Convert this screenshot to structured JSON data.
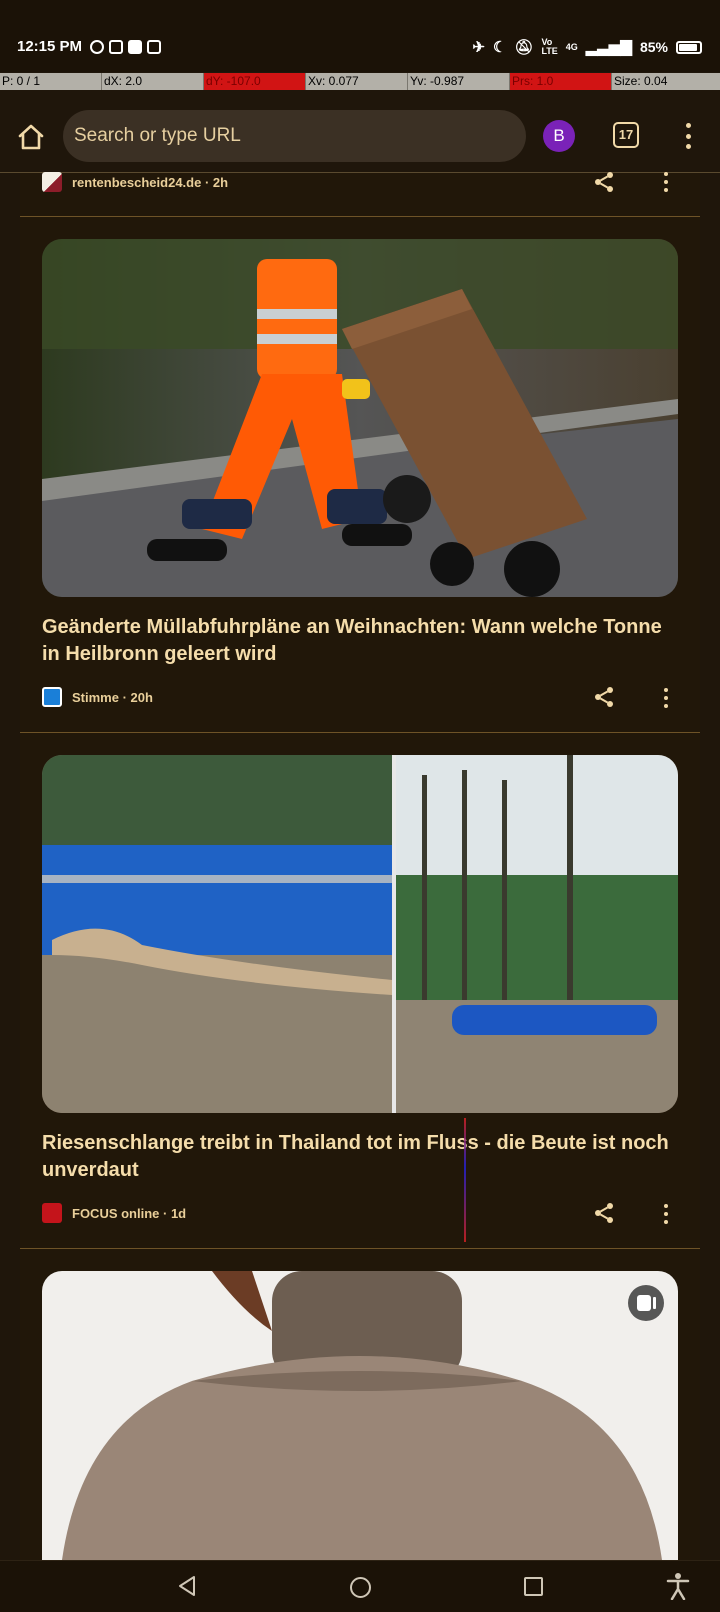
{
  "status_bar": {
    "time": "12:15 PM",
    "network": "4G",
    "battery": "85%",
    "left_icons": [
      "record-icon",
      "vibrate-icon",
      "app-icon",
      "eye-icon"
    ],
    "right_icons": [
      "airplane-off-icon",
      "moon-icon",
      "bell-off-icon",
      "volte-icon",
      "signal-icon",
      "battery-icon"
    ]
  },
  "debug_bar": {
    "cells": [
      "P: 0 / 1",
      "dX: 2.0",
      "dY: -107.0",
      "Xv: 0.077",
      "Yv: -0.987",
      "Prs: 1.0",
      "Size: 0.04"
    ],
    "red_cells": [
      2,
      5
    ]
  },
  "toolbar": {
    "url_placeholder": "Search or type URL",
    "avatar_letter": "B",
    "tab_count": "17"
  },
  "feed": {
    "cards": [
      {
        "source": "rentenbescheid24.de · 2h",
        "title": ""
      },
      {
        "source": "Stimme · 20h",
        "title": "Geänderte Müllabfuhrpläne an Weihnachten: Wann welche Tonne in Heilbronn geleert wird"
      },
      {
        "source": "FOCUS online · 1d",
        "title": "Riesenschlange treibt in Thailand tot im Fluss - die Beute ist noch unverdaut"
      },
      {
        "source": "",
        "title": ""
      }
    ]
  },
  "colors": {
    "background": "#1f160b",
    "accent_text": "#f1d9a8",
    "avatar": "#7a22b8",
    "divider": "#6e5327"
  }
}
